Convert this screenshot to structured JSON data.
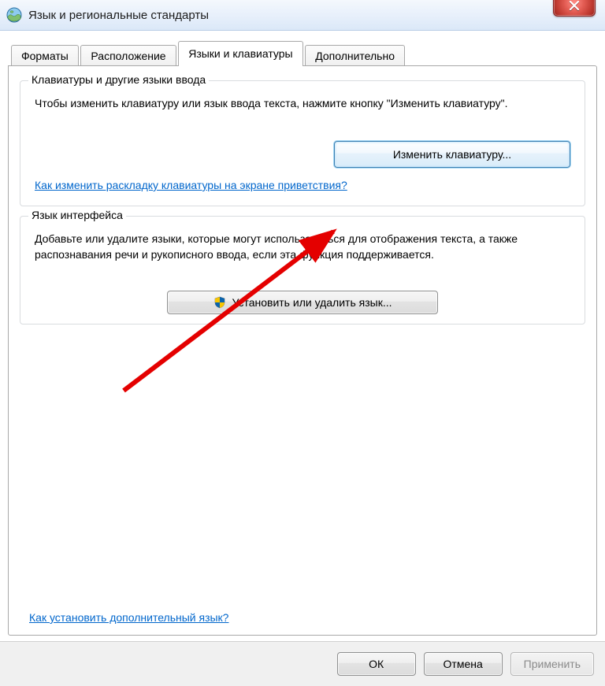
{
  "window": {
    "title": "Язык и региональные стандарты"
  },
  "tabs": {
    "formats": "Форматы",
    "location": "Расположение",
    "keyboards": "Языки и клавиатуры",
    "advanced": "Дополнительно"
  },
  "group_keyboards": {
    "legend": "Клавиатуры и другие языки ввода",
    "desc": "Чтобы изменить клавиатуру или язык ввода текста, нажмите кнопку \"Изменить клавиатуру\".",
    "button": "Изменить клавиатуру...",
    "link": "Как изменить раскладку клавиатуры на экране приветствия?"
  },
  "group_uilang": {
    "legend": "Язык интерфейса",
    "desc": "Добавьте или удалите языки, которые могут использоваться для отображения текста, а также распознавания речи и рукописного ввода, если эта функция поддерживается.",
    "button": "Установить или удалить язык..."
  },
  "bottom_link": "Как установить дополнительный язык?",
  "buttons": {
    "ok": "ОК",
    "cancel": "Отмена",
    "apply": "Применить"
  }
}
